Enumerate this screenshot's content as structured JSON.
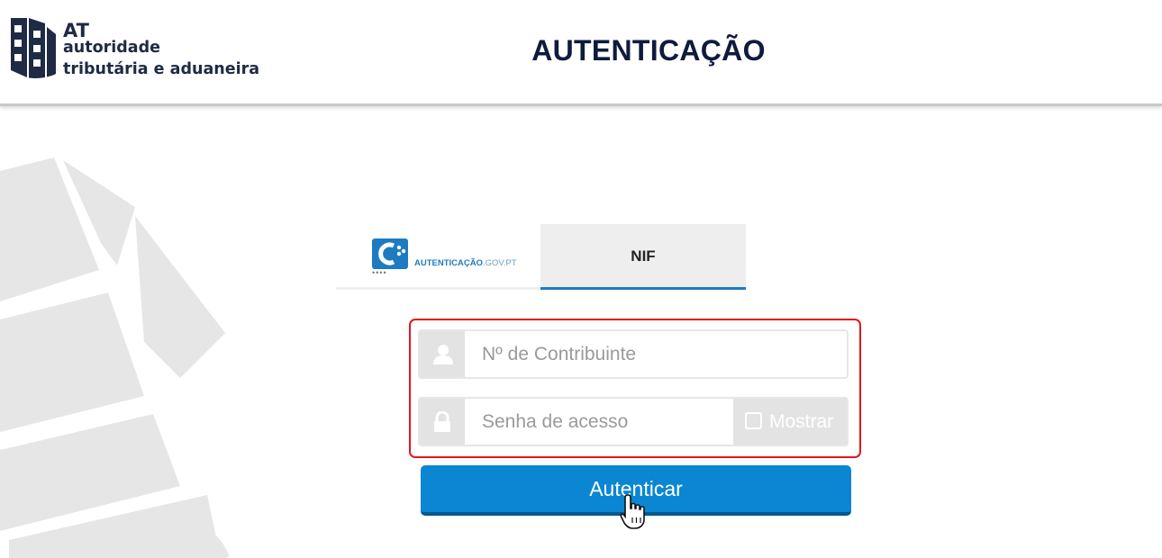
{
  "header": {
    "logo": {
      "abbr": "AT",
      "line1": "autoridade",
      "line2": "tributária e aduaneira"
    },
    "title": "AUTENTICAÇÃO"
  },
  "tabs": {
    "gov": {
      "brand_bold": "AUTENTICAÇÃO",
      "brand_light": ".GOV.PT",
      "dots": "••••"
    },
    "nif": {
      "label": "NIF",
      "active": true
    }
  },
  "form": {
    "nif_field": {
      "placeholder": "Nº de Contribuinte",
      "value": "",
      "icon": "user-icon"
    },
    "password_field": {
      "placeholder": "Senha de acesso",
      "value": "",
      "icon": "lock-icon"
    },
    "show_toggle": {
      "label": "Mostrar",
      "checked": false
    }
  },
  "submit": {
    "label": "Autenticar"
  },
  "colors": {
    "brand_navy": "#0f1b3d",
    "accent_blue": "#0a86d2",
    "highlight_red": "#e3161e",
    "addon_gray": "#e3e3e3"
  }
}
